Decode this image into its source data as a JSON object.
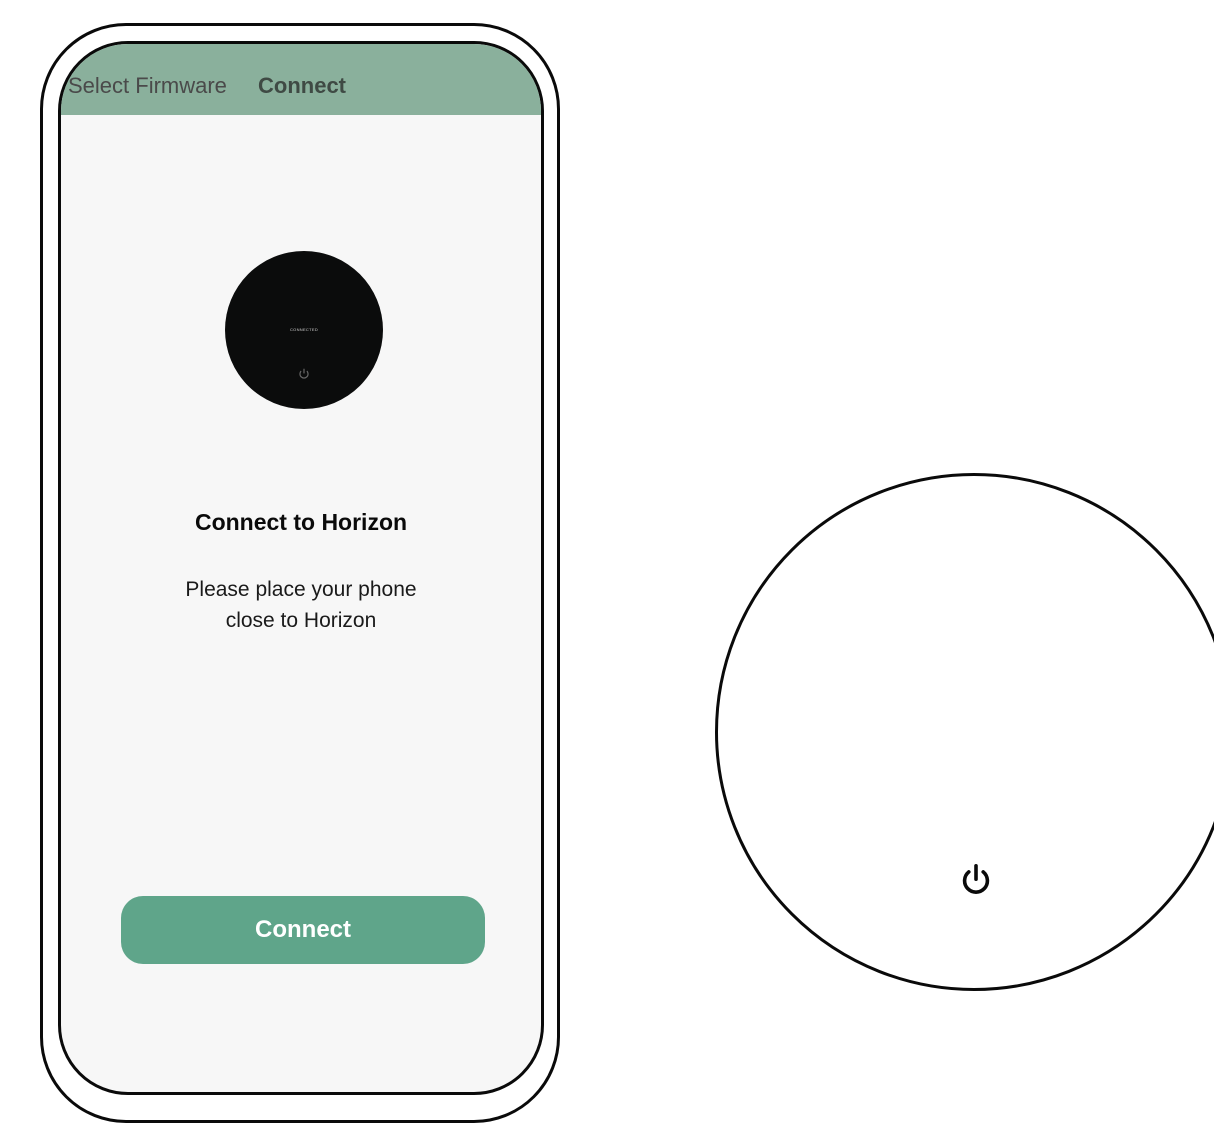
{
  "header": {
    "select_firmware_label": "Select Firmware",
    "connect_label": "Connect"
  },
  "device_thumbnail": {
    "label": "CONNECTED",
    "icon": "power-icon"
  },
  "content": {
    "title": "Connect to Horizon",
    "description_line1": "Please place your phone",
    "description_line2": "close to Horizon"
  },
  "button": {
    "connect_label": "Connect"
  },
  "device_illustration": {
    "icon": "power-icon"
  },
  "colors": {
    "header_bg": "#8ab09c",
    "button_bg": "#5fa58a",
    "screen_bg": "#f7f7f7",
    "device_thumb": "#0b0c0c"
  }
}
